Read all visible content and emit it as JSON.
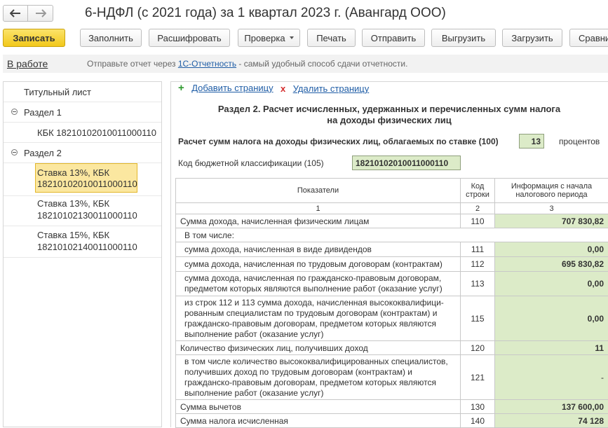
{
  "window": {
    "title": "6-НДФЛ (с 2021 года) за 1 квартал 2023 г. (Авангард ООО)",
    "back_icon": "arrow-left-icon",
    "forward_icon": "arrow-right-icon"
  },
  "toolbar": {
    "save": "Записать",
    "fill": "Заполнить",
    "decode": "Расшифровать",
    "check": "Проверка",
    "print": "Печать",
    "send": "Отправить",
    "unload": "Выгрузить",
    "load": "Загрузить",
    "compare": "Сравни"
  },
  "status": {
    "state": "В работе",
    "hint_before": "Отправьте отчет через ",
    "hint_link": "1С-Отчетность",
    "hint_after": " - самый удобный способ сдачи отчетности."
  },
  "tree": {
    "title_page": "Титульный лист",
    "section1": "Раздел 1",
    "section1_kbk": "КБК 18210102010011000110",
    "section2": "Раздел 2",
    "rate13_line1": "Ставка 13%, КБК",
    "rate13_line2": "18210102010011000110",
    "rate13b_line1": "Ставка 13%, КБК",
    "rate13b_line2": "18210102130011000110",
    "rate15_line1": "Ставка 15%, КБК",
    "rate15_line2": "18210102140011000110"
  },
  "actions": {
    "add_page": "Добавить страницу",
    "delete_page": "Удалить страницу"
  },
  "form": {
    "section_title_1": "Раздел 2. Расчет исчисленных, удержанных и перечисленных сумм налога",
    "section_title_2": "на доходы физических лиц",
    "rate_label": "Расчет сумм налога на доходы физических лиц, облагаемых по ставке  (100)",
    "rate_value": "13",
    "rate_unit": "процентов",
    "kbk_label": "Код бюджетной классификации  (105)",
    "kbk_value": "18210102010011000110"
  },
  "table": {
    "headers": {
      "indicators": "Показатели",
      "code": "Код строки",
      "info": "Информация с начала налогового периода"
    },
    "colnums": [
      "1",
      "2",
      "3"
    ],
    "rows": [
      {
        "label": "Сумма дохода, начисленная физическим лицам",
        "code": "110",
        "value": "707 830,82"
      },
      {
        "label": "В том числе:",
        "code": "",
        "value": ""
      },
      {
        "label": "сумма дохода, начисленная в виде дивидендов",
        "code": "111",
        "value": "0,00"
      },
      {
        "label": "сумма дохода, начисленная по трудовым договорам (контрактам)",
        "code": "112",
        "value": "695 830,82"
      },
      {
        "label": "сумма дохода, начисленная по гражданско-правовым договорам, предметом которых являются выполнение работ (оказание услуг)",
        "code": "113",
        "value": "0,00"
      },
      {
        "label": "из строк 112 и 113 сумма дохода, начисленная высококвалифици-рованным специалистам по трудовым договорам (контрактам) и гражданско-правовым договорам, предметом которых являются выполнение работ (оказание услуг)",
        "code": "115",
        "value": "0,00"
      },
      {
        "label": "Количество физических лиц, получивших доход",
        "code": "120",
        "value": "11"
      },
      {
        "label": "в том числе количество высококвалифицированных специалистов, получивших доход по трудовым договорам (контрактам) и гражданско-правовым договорам, предметом которых являются выполнение работ (оказание услуг)",
        "code": "121",
        "value": "-"
      },
      {
        "label": "Сумма вычетов",
        "code": "130",
        "value": "137 600,00"
      },
      {
        "label": "Сумма налога исчисленная",
        "code": "140",
        "value": "74 128"
      }
    ]
  }
}
